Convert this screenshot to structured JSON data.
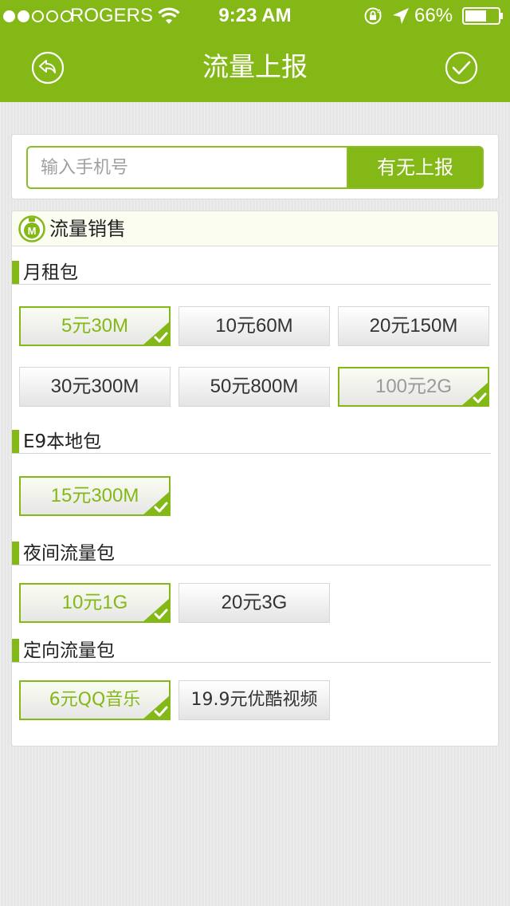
{
  "status": {
    "carrier": "ROGERS",
    "time": "9:23 AM",
    "battery": "66%",
    "battery_level": 0.66,
    "signal_bars": 2
  },
  "nav": {
    "title": "流量上报",
    "back_icon": "back-arrow-circle-icon",
    "confirm_icon": "check-circle-icon"
  },
  "search": {
    "placeholder": "输入手机号",
    "button_label": "有无上报"
  },
  "card": {
    "title": "流量销售",
    "icon": "m-badge-icon"
  },
  "sections": [
    {
      "title": "月租包",
      "options": [
        "5元30M",
        "10元60M",
        "20元150M",
        "30元300M",
        "50元800M",
        "100元2G"
      ]
    },
    {
      "title": "E9本地包",
      "options": [
        "15元300M"
      ]
    },
    {
      "title": "夜间流量包",
      "options": [
        "10元1G",
        "20元3G"
      ]
    },
    {
      "title": "定向流量包",
      "options": [
        "6元QQ音乐",
        "19.9元优酷视频"
      ]
    }
  ],
  "selected": [
    "5元30M",
    "100元2G",
    "15元300M",
    "10元1G",
    "6元QQ音乐"
  ],
  "colors": {
    "accent": "#84b817",
    "background": "#e6e6e6"
  }
}
